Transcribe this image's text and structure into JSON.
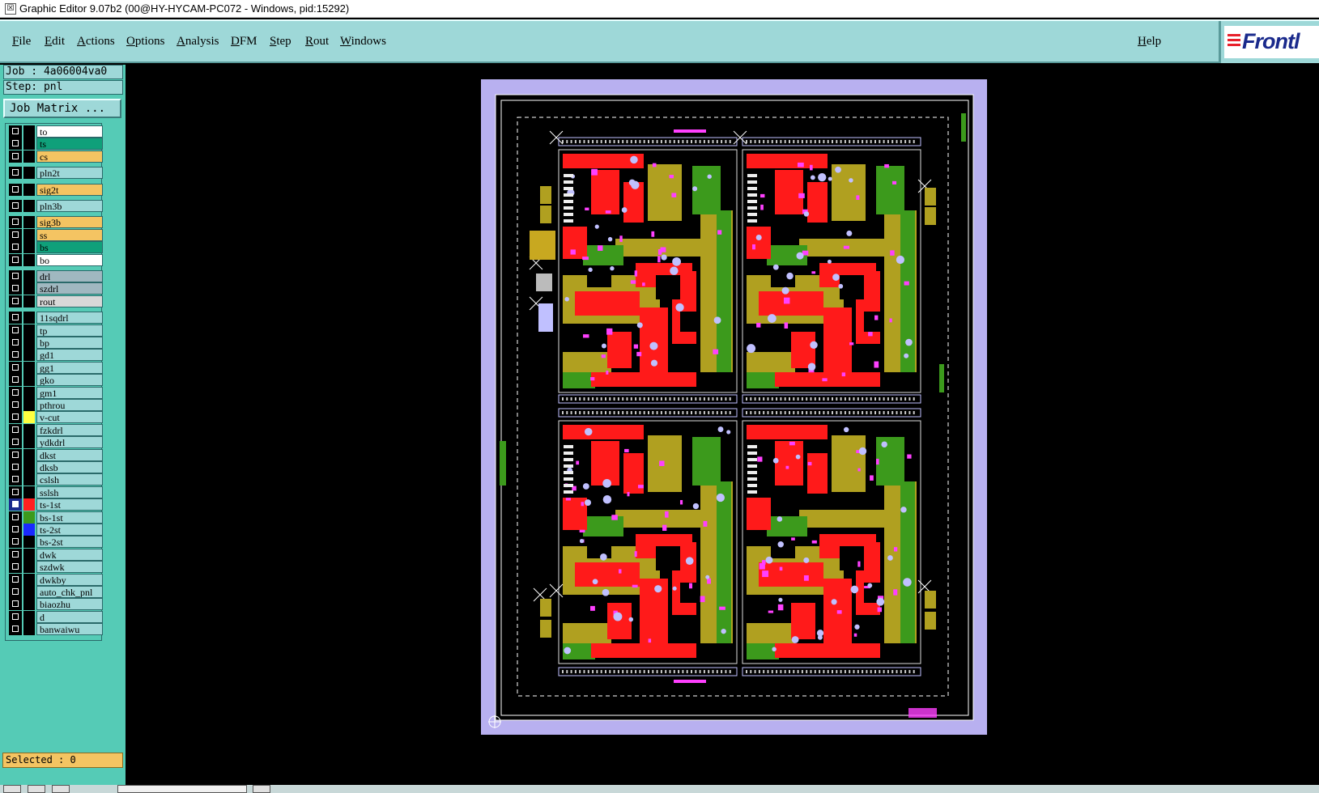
{
  "window": {
    "title": "Graphic Editor 9.07b2 (00@HY-HYCAM-PC072 - Windows, pid:15292)"
  },
  "menubar": {
    "items": [
      "File",
      "Edit",
      "Actions",
      "Options",
      "Analysis",
      "DFM",
      "Step",
      "Rout",
      "Windows"
    ],
    "help": "Help",
    "logo_text": "Frontl"
  },
  "panel": {
    "job": "Job : 4a06004va0",
    "step": "Step: pnl",
    "job_matrix": "Job Matrix ...",
    "selected": "Selected : 0"
  },
  "layers": [
    {
      "name": "to",
      "color": "#ffffff",
      "swatch": "#000000",
      "checked": false
    },
    {
      "name": "ts",
      "color": "#0fa07a",
      "swatch": "#000000",
      "checked": false
    },
    {
      "name": "cs",
      "color": "#f4c462",
      "swatch": "#000000",
      "checked": false
    },
    {
      "name": "pln2t",
      "color": "#9ed8d8",
      "swatch": "#000000",
      "checked": false
    },
    {
      "name": "sig2t",
      "color": "#f4c462",
      "swatch": "#000000",
      "checked": false
    },
    {
      "name": "pln3b",
      "color": "#9ed8d8",
      "swatch": "#000000",
      "checked": false
    },
    {
      "name": "sig3b",
      "color": "#f4c462",
      "swatch": "#000000",
      "checked": false
    },
    {
      "name": "ss",
      "color": "#f4c462",
      "swatch": "#000000",
      "checked": false
    },
    {
      "name": "bs",
      "color": "#0fa07a",
      "swatch": "#000000",
      "checked": false
    },
    {
      "name": "bo",
      "color": "#ffffff",
      "swatch": "#000000",
      "checked": false
    },
    {
      "name": "drl",
      "color": "#a0b8c0",
      "swatch": "#000000",
      "checked": false
    },
    {
      "name": "szdrl",
      "color": "#a0b8c0",
      "swatch": "#000000",
      "checked": false
    },
    {
      "name": "rout",
      "color": "#d8d8d8",
      "swatch": "#000000",
      "checked": false
    },
    {
      "name": "11sqdrl",
      "color": "#9ed8d8",
      "swatch": "#000000",
      "checked": false
    },
    {
      "name": "tp",
      "color": "#9ed8d8",
      "swatch": "#000000",
      "checked": false
    },
    {
      "name": "bp",
      "color": "#9ed8d8",
      "swatch": "#000000",
      "checked": false
    },
    {
      "name": "gd1",
      "color": "#9ed8d8",
      "swatch": "#000000",
      "checked": false
    },
    {
      "name": "gg1",
      "color": "#9ed8d8",
      "swatch": "#000000",
      "checked": false
    },
    {
      "name": "gko",
      "color": "#9ed8d8",
      "swatch": "#000000",
      "checked": false
    },
    {
      "name": "gm1",
      "color": "#9ed8d8",
      "swatch": "#000000",
      "checked": false
    },
    {
      "name": "pthrou",
      "color": "#9ed8d8",
      "swatch": "#000000",
      "checked": false
    },
    {
      "name": "v-cut",
      "color": "#9ed8d8",
      "swatch": "#ffff40",
      "checked": false
    },
    {
      "name": "fzkdrl",
      "color": "#9ed8d8",
      "swatch": "#000000",
      "checked": false
    },
    {
      "name": "ydkdrl",
      "color": "#9ed8d8",
      "swatch": "#000000",
      "checked": false
    },
    {
      "name": "dkst",
      "color": "#9ed8d8",
      "swatch": "#000000",
      "checked": false
    },
    {
      "name": "dksb",
      "color": "#9ed8d8",
      "swatch": "#000000",
      "checked": false
    },
    {
      "name": "cslsh",
      "color": "#9ed8d8",
      "swatch": "#000000",
      "checked": false
    },
    {
      "name": "sslsh",
      "color": "#9ed8d8",
      "swatch": "#000000",
      "checked": false
    },
    {
      "name": "ts-1st",
      "color": "#9ed8d8",
      "swatch": "#ff2020",
      "checked": true
    },
    {
      "name": "bs-1st",
      "color": "#9ed8d8",
      "swatch": "#3c9a1c",
      "checked": false
    },
    {
      "name": "ts-2st",
      "color": "#9ed8d8",
      "swatch": "#1a2aff",
      "checked": false
    },
    {
      "name": "bs-2st",
      "color": "#9ed8d8",
      "swatch": "#000000",
      "checked": false
    },
    {
      "name": "dwk",
      "color": "#9ed8d8",
      "swatch": "#000000",
      "checked": false
    },
    {
      "name": "szdwk",
      "color": "#9ed8d8",
      "swatch": "#000000",
      "checked": false
    },
    {
      "name": "dwkby",
      "color": "#9ed8d8",
      "swatch": "#000000",
      "checked": false
    },
    {
      "name": "auto_chk_pnl",
      "color": "#9ed8d8",
      "swatch": "#000000",
      "checked": false
    },
    {
      "name": "biaozhu",
      "color": "#9ed8d8",
      "swatch": "#000000",
      "checked": false
    },
    {
      "name": "d",
      "color": "#9ed8d8",
      "swatch": "#000000",
      "checked": false
    },
    {
      "name": "banwaiwu",
      "color": "#9ed8d8",
      "swatch": "#000000",
      "checked": false
    }
  ],
  "colors": {
    "panel_border": "#b8b0f0",
    "copper_red": "#ff1a1a",
    "copper_green": "#3c9a1c",
    "copper_olive": "#b0a020",
    "magenta": "#ff40ff",
    "lavender": "#c0c0ff",
    "yellow": "#e8d800"
  }
}
